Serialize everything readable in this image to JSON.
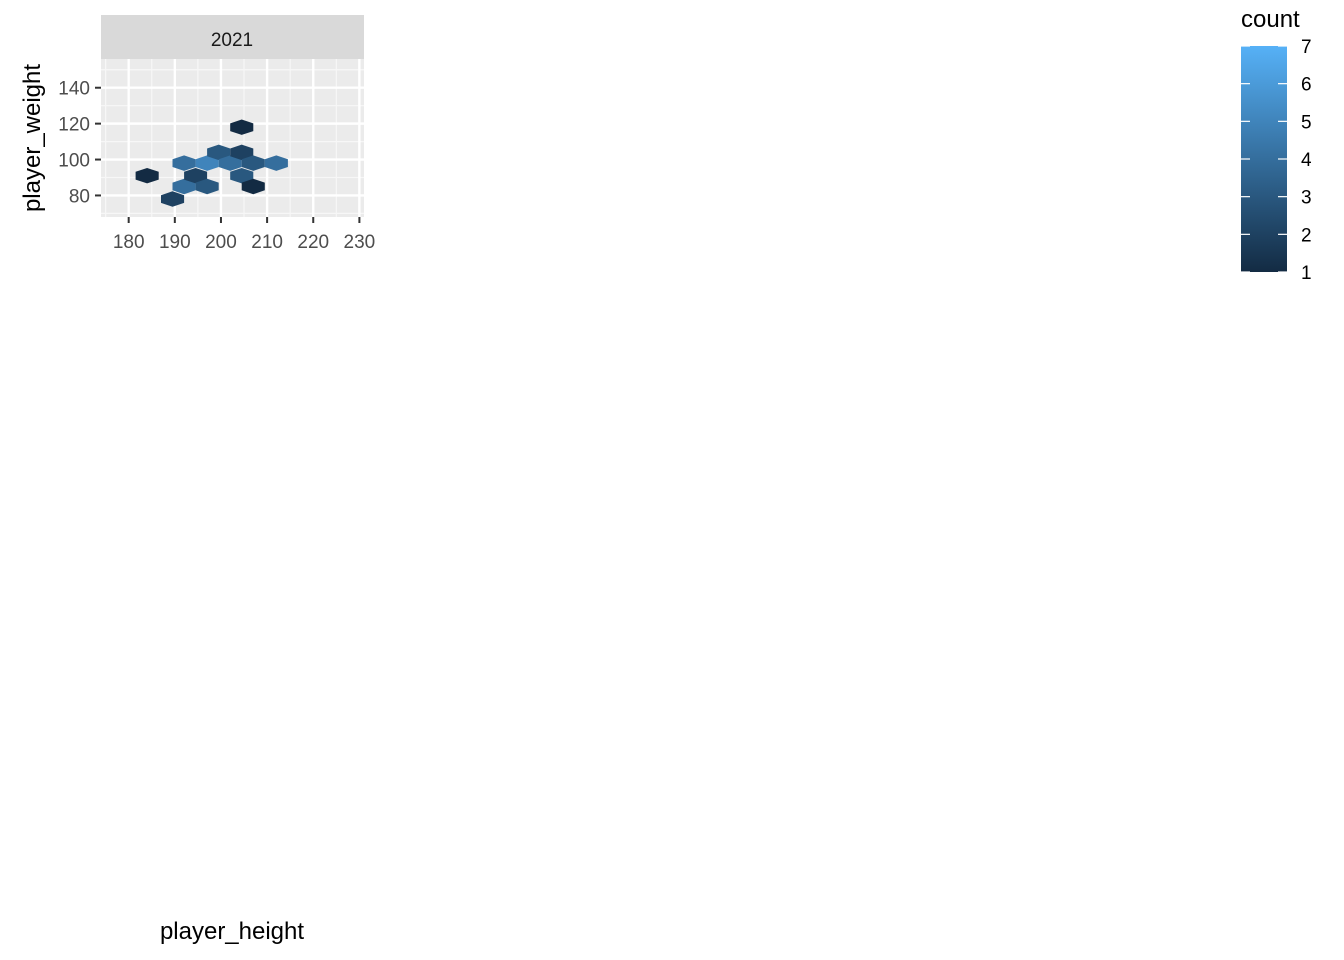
{
  "chart_data": {
    "type": "heatmap",
    "geom": "hexbin",
    "panels": [
      {
        "facet_label": "2021",
        "xlim": [
          174,
          231
        ],
        "ylim": [
          68,
          156
        ],
        "x_ticks": [
          180,
          190,
          200,
          210,
          220,
          230
        ],
        "y_ticks": [
          80,
          100,
          120,
          140
        ],
        "bins": [
          {
            "x": 184,
            "y": 91,
            "count": 1
          },
          {
            "x": 189.5,
            "y": 78,
            "count": 2
          },
          {
            "x": 192,
            "y": 85,
            "count": 4
          },
          {
            "x": 192,
            "y": 98,
            "count": 4
          },
          {
            "x": 194.5,
            "y": 91,
            "count": 2
          },
          {
            "x": 197,
            "y": 85,
            "count": 3
          },
          {
            "x": 197,
            "y": 98,
            "count": 5
          },
          {
            "x": 199.5,
            "y": 104,
            "count": 3
          },
          {
            "x": 202,
            "y": 98,
            "count": 4
          },
          {
            "x": 204.5,
            "y": 91,
            "count": 3
          },
          {
            "x": 204.5,
            "y": 104,
            "count": 2
          },
          {
            "x": 204.5,
            "y": 118,
            "count": 1
          },
          {
            "x": 207,
            "y": 85,
            "count": 1
          },
          {
            "x": 207,
            "y": 98,
            "count": 3
          },
          {
            "x": 212,
            "y": 98,
            "count": 4
          }
        ]
      }
    ],
    "xlabel": "player_height",
    "ylabel": "player_weight",
    "legend": {
      "title": "count",
      "min": 1,
      "max": 7,
      "breaks": [
        1,
        2,
        3,
        4,
        5,
        6,
        7
      ],
      "low_color": "#132B43",
      "high_color": "#56B1F7",
      "position": "top-right"
    },
    "grid": true
  }
}
